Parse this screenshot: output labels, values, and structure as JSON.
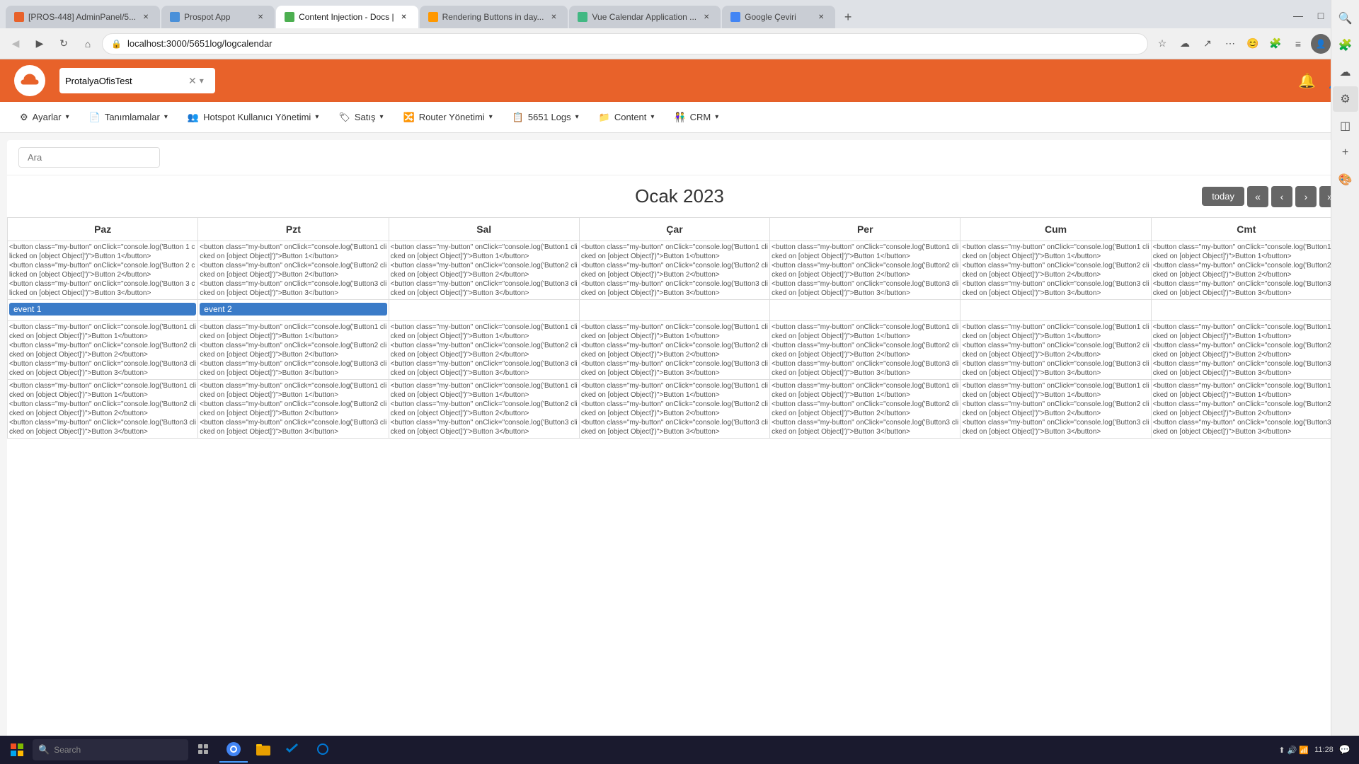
{
  "browser": {
    "tabs": [
      {
        "id": "tab1",
        "title": "[PROS-448] AdminPanel/5...",
        "favicon_color": "#e8622a",
        "active": false
      },
      {
        "id": "tab2",
        "title": "Prospot App",
        "favicon_color": "#4a90d9",
        "active": false
      },
      {
        "id": "tab3",
        "title": "Content Injection - Docs |",
        "favicon_color": "#4caf50",
        "active": true
      },
      {
        "id": "tab4",
        "title": "Rendering Buttons in day...",
        "favicon_color": "#ff9800",
        "active": false
      },
      {
        "id": "tab5",
        "title": "Vue Calendar Application ...",
        "favicon_color": "#42b883",
        "active": false
      },
      {
        "id": "tab6",
        "title": "Google Çeviri",
        "favicon_color": "#4285f4",
        "active": false
      }
    ],
    "url": "localhost:3000/5651log/logcalendar",
    "new_tab_label": "+",
    "minimize": "—",
    "maximize": "□",
    "close": "✕"
  },
  "right_panel_icons": [
    {
      "name": "extensions-icon",
      "symbol": "🧩"
    },
    {
      "name": "collections-icon",
      "symbol": "☁"
    },
    {
      "name": "tools-icon",
      "symbol": "⚙"
    },
    {
      "name": "sidebar-icon",
      "symbol": "◫"
    },
    {
      "name": "add-icon",
      "symbol": "+"
    },
    {
      "name": "color-icon",
      "symbol": "🎨"
    },
    {
      "name": "settings-icon2",
      "symbol": "⚙"
    }
  ],
  "app": {
    "logo_alt": "cloud logo",
    "search_placeholder": "ProtalyaOfisTest",
    "search_clear": "✕",
    "search_dropdown": "▾",
    "bell_icon": "🔔",
    "user_icon": "👤"
  },
  "menu": {
    "items": [
      {
        "icon": "⚙",
        "label": "Ayarlar",
        "has_dropdown": true
      },
      {
        "icon": "📄",
        "label": "Tanımlamalar",
        "has_dropdown": true
      },
      {
        "icon": "👥",
        "label": "Hotspot Kullanıcı Yönetimi",
        "has_dropdown": true
      },
      {
        "icon": "🏷",
        "label": "Satış",
        "has_dropdown": true
      },
      {
        "icon": "🔀",
        "label": "Router Yönetimi",
        "has_dropdown": true
      },
      {
        "icon": "📋",
        "label": "5651 Logs",
        "has_dropdown": true
      },
      {
        "icon": "📁",
        "label": "Content",
        "has_dropdown": true
      },
      {
        "icon": "👫",
        "label": "CRM",
        "has_dropdown": true
      }
    ]
  },
  "content_search": {
    "placeholder": "Ara"
  },
  "calendar": {
    "title": "Ocak 2023",
    "today_btn": "today",
    "nav_first": "«",
    "nav_prev": "‹",
    "nav_next": "›",
    "nav_last": "»",
    "days": [
      "Paz",
      "Pzt",
      "Sal",
      "Çar",
      "Per",
      "Cum",
      "Cmt"
    ],
    "cell_content": "<button class=\"my-button\" onClick=\"console.log('Button 1 clicked on [object Object]')\">Button 1</button> <button class=\"my-button\" onClick=\"console.log('Button 2 clicked on [object Object]')\">Button 2</button> <button class=\"my-button\" onClick=\"console.log('Button 3 clicked on [object Object]')\">Button 3</button>",
    "events": [
      {
        "id": 1,
        "label": "event 1",
        "day": 0
      },
      {
        "id": 2,
        "label": "event 2",
        "day": 1
      }
    ]
  },
  "taskbar": {
    "time": "11:28",
    "date": "",
    "search_placeholder": "🔍",
    "icons": [
      "⊞",
      "🔍",
      "📁",
      "🌐",
      "💻",
      "🔵",
      "🟠",
      "📘"
    ]
  }
}
